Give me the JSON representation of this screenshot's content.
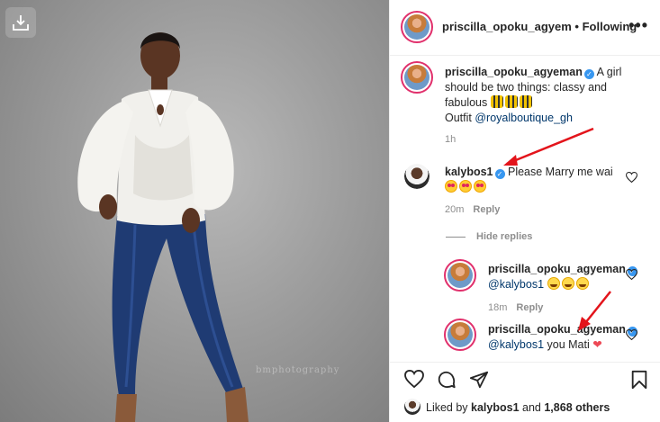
{
  "header": {
    "username": "priscilla_opoku_agyem",
    "separator": "•",
    "follow_status": "Following",
    "more_icon": "more-horizontal-icon"
  },
  "caption": {
    "username": "priscilla_opoku_agyeman",
    "text_line1": " A girl",
    "text_line2": "should be two things: classy and",
    "text_line3": "fabulous",
    "outfit_prefix": "Outfit ",
    "outfit_mention": "@royalboutique_gh",
    "time": "1h"
  },
  "comments": [
    {
      "username": "kalybos1",
      "text": " Please Marry me wai",
      "time": "20m",
      "reply_label": "Reply"
    }
  ],
  "hide_replies_label": "Hide replies",
  "replies": [
    {
      "username": "priscilla_opoku_agyeman",
      "mention": "@kalybos1",
      "text": "",
      "time": "18m",
      "reply_label": "Reply"
    },
    {
      "username": "priscilla_opoku_agyeman",
      "mention": "@kalybos1",
      "text": " you Mati "
    }
  ],
  "likes": {
    "prefix": "Liked by ",
    "user": "kalybos1",
    "middle": " and ",
    "count": "1,868 others"
  },
  "photo": {
    "watermark": "bmphotography"
  },
  "colors": {
    "verified": "#3897f0",
    "arrow": "#e3141b",
    "mention": "#00376b",
    "muted": "#8e8e8e"
  }
}
